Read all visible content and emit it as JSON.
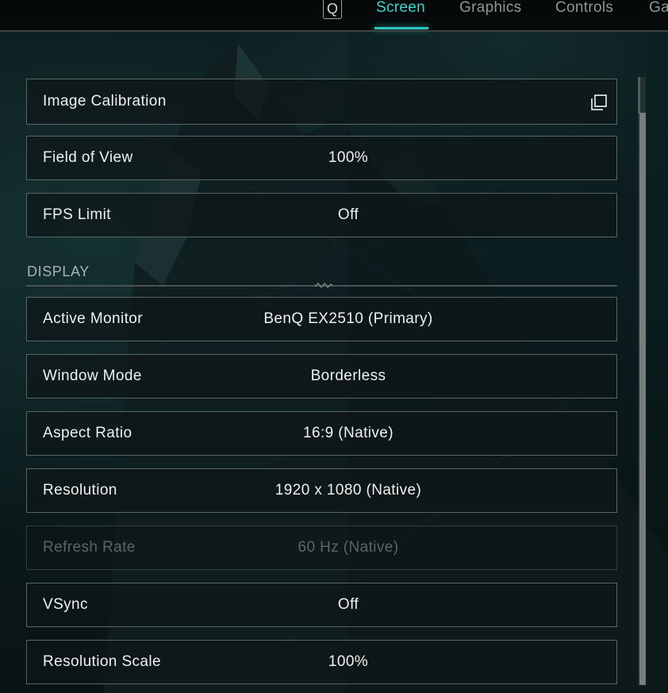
{
  "tabs": {
    "key_hint": "Q",
    "items": [
      "Screen",
      "Graphics",
      "Controls",
      "Ga"
    ],
    "active": "Screen"
  },
  "settings_top": [
    {
      "label": "Image Calibration",
      "value": "",
      "icon": "copy-window-icon"
    },
    {
      "label": "Field of View",
      "value": "100%"
    },
    {
      "label": "FPS Limit",
      "value": "Off"
    }
  ],
  "display": {
    "section_title": "DISPLAY",
    "rows": [
      {
        "label": "Active Monitor",
        "value": "BenQ EX2510 (Primary)"
      },
      {
        "label": "Window Mode",
        "value": "Borderless"
      },
      {
        "label": "Aspect Ratio",
        "value": "16:9 (Native)"
      },
      {
        "label": "Resolution",
        "value": "1920 x 1080 (Native)"
      },
      {
        "label": "Refresh Rate",
        "value": "60 Hz (Native)",
        "disabled": true
      },
      {
        "label": "VSync",
        "value": "Off"
      },
      {
        "label": "Resolution Scale",
        "value": "100%"
      }
    ]
  },
  "colors": {
    "accent": "#3ed6cf",
    "text": "#eef1ef",
    "muted": "#8e9797",
    "disabled": "#5b6565",
    "border": "#5b6464"
  }
}
